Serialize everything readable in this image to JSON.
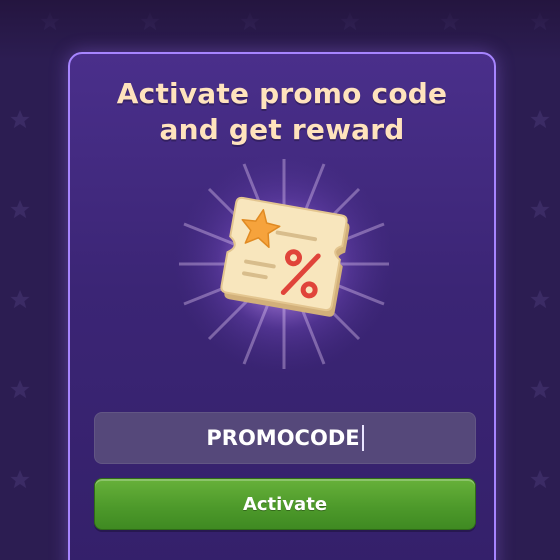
{
  "dialog": {
    "title": "Activate promo code\nand get reward",
    "coupon_icon": "discount-ticket-icon",
    "promo_input": {
      "value": "PROMOCODE"
    },
    "activate_label": "Activate"
  },
  "colors": {
    "background": "#2c1d52",
    "panel": "#3b2575",
    "panel_border": "#a785ff",
    "title_text": "#ffe3bd",
    "input_bg": "#55487a",
    "button_green": "#4e9a2b",
    "ticket": "#f6e2b6",
    "star": "#f7a43a",
    "percent": "#e0443a"
  }
}
